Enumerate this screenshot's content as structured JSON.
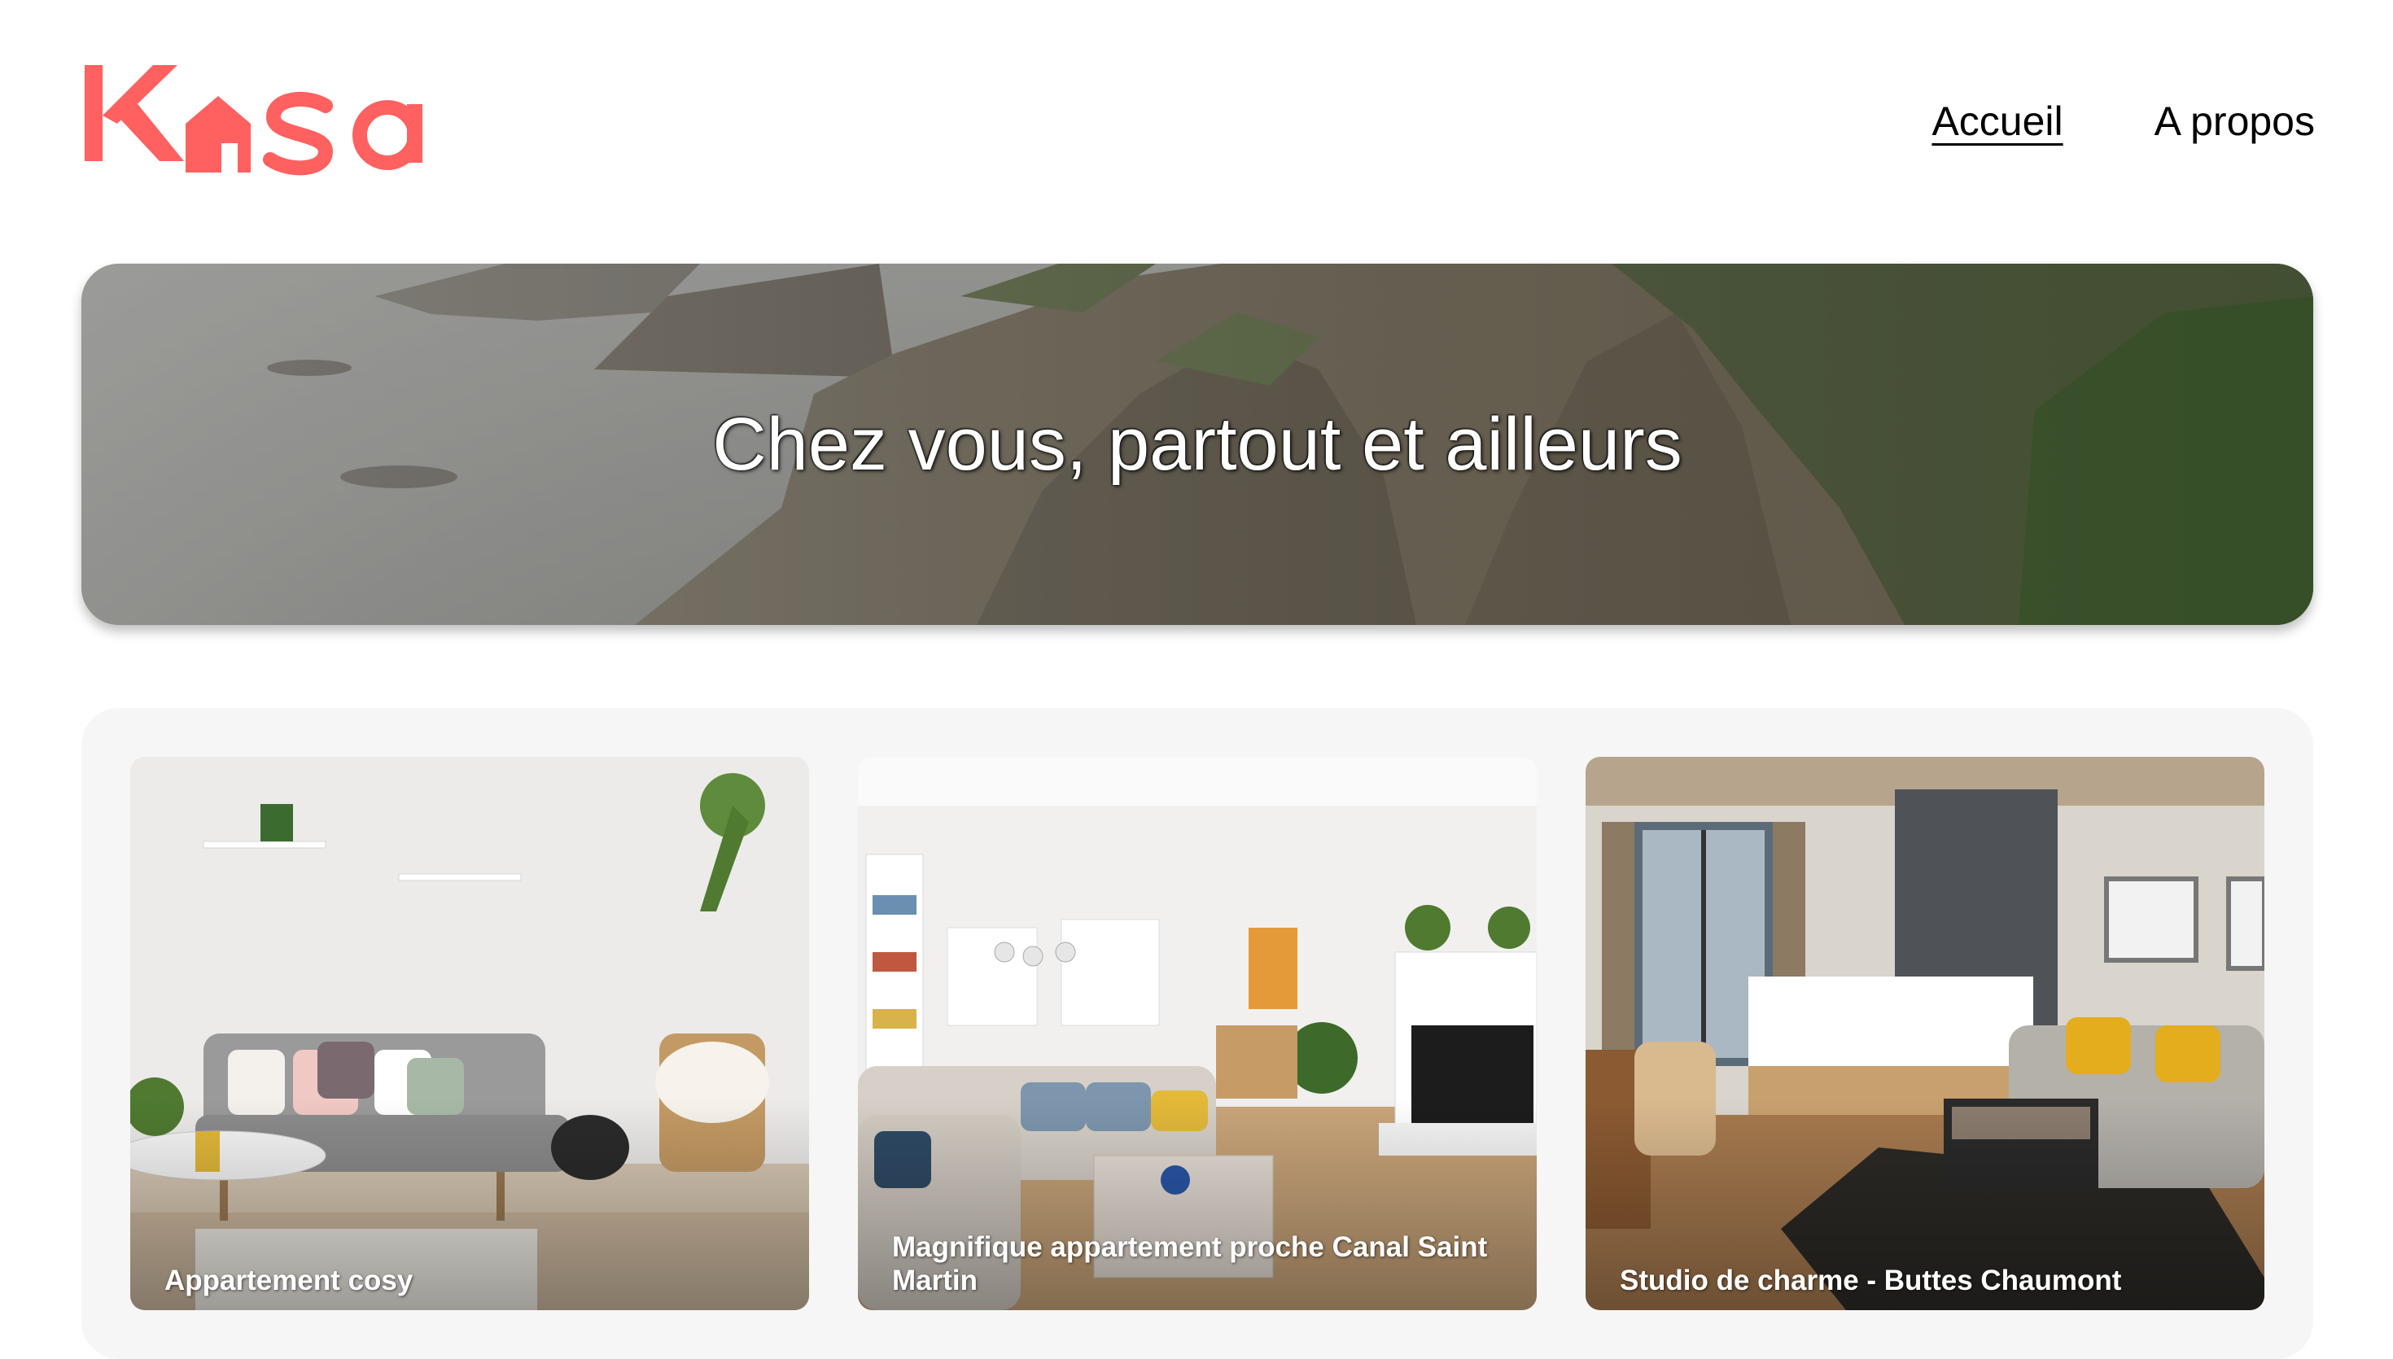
{
  "brand": {
    "name": "Kasa",
    "accent_color": "#ff6060"
  },
  "nav": {
    "items": [
      {
        "label": "Accueil",
        "active": true
      },
      {
        "label": "A propos",
        "active": false
      }
    ]
  },
  "banner": {
    "title": "Chez vous, partout et ailleurs",
    "image_icon": "coastal-cliffs-image"
  },
  "gallery": {
    "cards": [
      {
        "title": "Appartement cosy",
        "image_icon": "living-room-photo"
      },
      {
        "title": "Magnifique appartement proche Canal Saint Martin",
        "image_icon": "open-plan-living-photo"
      },
      {
        "title": "Studio de charme - Buttes Chaumont",
        "image_icon": "studio-bedroom-photo"
      }
    ]
  }
}
